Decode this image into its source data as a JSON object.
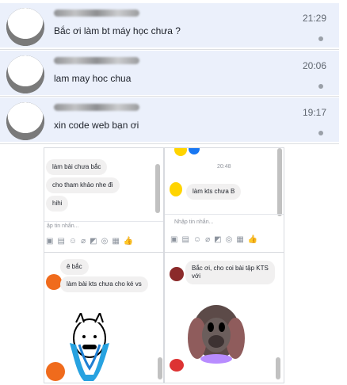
{
  "conversations": [
    {
      "message": "Bắc ơi làm bt máy học chưa ?",
      "time": "21:29"
    },
    {
      "message": "lam may hoc chua",
      "time": "20:06"
    },
    {
      "message": "xin code web bạn ơi",
      "time": "19:17"
    }
  ],
  "chat_panels": {
    "top_left": {
      "messages": [
        "làm bài chưa bắc",
        "cho tham khảo nhe đi",
        "hihi"
      ],
      "input_placeholder": "ập tin nhắn..."
    },
    "top_right": {
      "time": "20:48",
      "messages": [
        "làm kts chưa B"
      ],
      "input_placeholder": "Nhập tin nhắn..."
    },
    "bottom_left": {
      "messages": [
        "ê bắc",
        "làm bài kts chưa cho ké vs"
      ]
    },
    "bottom_right": {
      "messages": [
        "Bắc ơi, cho coi bài tập KTS\nvới"
      ]
    }
  },
  "icons": [
    "image-icon",
    "gif-icon",
    "emoji-icon",
    "attach-icon",
    "sticker-icon",
    "camera-icon",
    "more-icon",
    "like-icon"
  ]
}
